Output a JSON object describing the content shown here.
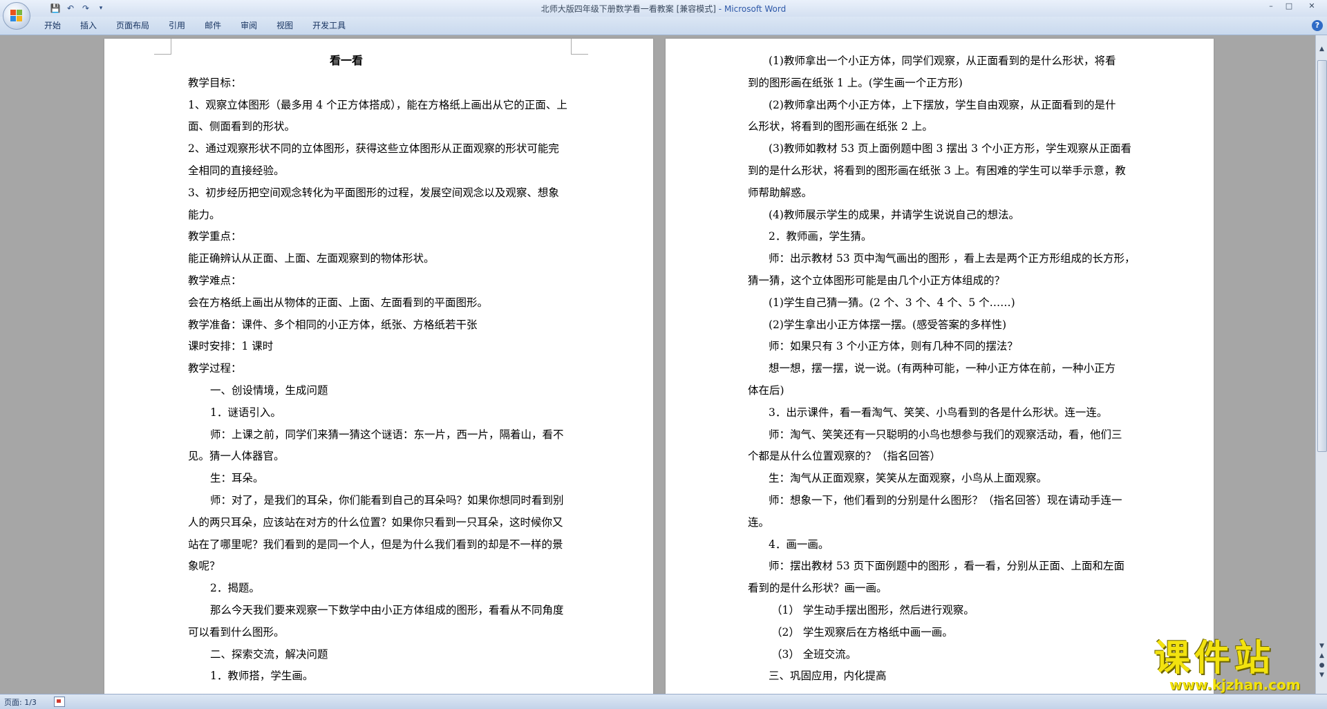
{
  "window": {
    "title": "北师大版四年级下册数学看一看教案 [兼容模式]",
    "app": "- Microsoft Word",
    "buttons": {
      "min": "–",
      "max": "□",
      "close": "✕"
    }
  },
  "quick_access": {
    "save_icon": "save-icon",
    "undo_icon": "undo-icon",
    "redo_icon": "redo-icon",
    "more_icon": "dropdown-icon"
  },
  "ribbon": {
    "tabs": [
      "开始",
      "插入",
      "页面布局",
      "引用",
      "邮件",
      "审阅",
      "视图",
      "开发工具"
    ],
    "help": "?"
  },
  "page1": {
    "lines": [
      "看一看",
      "教学目标：",
      "1、观察立体图形（最多用 4 个正方体搭成），能在方格纸上画出从它的正面、上",
      "面、侧面看到的形状。",
      "2、通过观察形状不同的立体图形，获得这些立体图形从正面观察的形状可能完",
      "全相同的直接经验。",
      "3、初步经历把空间观念转化为平面图形的过程，发展空间观念以及观察、想象",
      "能力。",
      "教学重点：",
      "能正确辨认从正面、上面、左面观察到的物体形状。",
      "教学难点：",
      "会在方格纸上画出从物体的正面、上面、左面看到的平面图形。",
      "教学准备：课件、多个相同的小正方体，纸张、方格纸若干张",
      "课时安排：1 课时",
      "教学过程：",
      "一、创设情境，生成问题",
      "1．谜语引入。",
      "师：上课之前，同学们来猜一猜这个谜语：东一片，西一片，隔着山，看不",
      "见。猜一人体器官。",
      "生：耳朵。",
      "师：对了，是我们的耳朵，你们能看到自己的耳朵吗？如果你想同时看到别",
      "人的两只耳朵，应该站在对方的什么位置？如果你只看到一只耳朵，这时候你又",
      "站在了哪里呢？我们看到的是同一个人，但是为什么我们看到的却是不一样的景",
      "象呢？",
      "2．揭题。",
      "那么今天我们要来观察一下数学中由小正方体组成的图形，看看从不同角度",
      "可以看到什么图形。",
      "二、探索交流，解决问题",
      "1．教师搭，学生画。"
    ]
  },
  "page2": {
    "lines": [
      "(1)教师拿出一个小正方体，同学们观察，从正面看到的是什么形状，将看",
      "到的图形画在纸张 1 上。(学生画一个正方形)",
      "(2)教师拿出两个小正方体，上下摆放，学生自由观察，从正面看到的是什",
      "么形状，将看到的图形画在纸张 2 上。",
      "(3)教师如教材 53 页上面例题中图 3 摆出 3 个小正方形，学生观察从正面看",
      "到的是什么形状，将看到的图形画在纸张 3 上。有困难的学生可以举手示意，教",
      "师帮助解惑。",
      "(4)教师展示学生的成果，并请学生说说自己的想法。",
      "2．教师画，学生猜。",
      "师：出示教材 53 页中淘气画出的图形 ，看上去是两个正方形组成的长方形，",
      "猜一猜，这个立体图形可能是由几个小正方体组成的？",
      "(1)学生自己猜一猜。(2 个、3 个、4 个、5 个……)",
      "(2)学生拿出小正方体摆一摆。(感受答案的多样性)",
      "师：如果只有 3 个小正方体，则有几种不同的摆法？",
      "想一想，摆一摆，说一说。(有两种可能，一种小正方体在前，一种小正方",
      "体在后)",
      "3．出示课件，看一看淘气、笑笑、小鸟看到的各是什么形状。连一连。",
      "师：淘气、笑笑还有一只聪明的小鸟也想参与我们的观察活动，看，他们三",
      "个都是从什么位置观察的？（指名回答）",
      "生：淘气从正面观察，笑笑从左面观察，小鸟从上面观察。",
      "师：想象一下，他们看到的分别是什么图形？（指名回答）现在请动手连一",
      "连。",
      "4．画一画。",
      "师：摆出教材 53 页下面例题中的图形 ，看一看，分别从正面、上面和左面",
      "看到的是什么形状？画一画。",
      "（1） 学生动手摆出图形，然后进行观察。",
      "（2） 学生观察后在方格纸中画一画。",
      "（3） 全班交流。",
      "三、巩固应用，内化提高"
    ]
  },
  "statusbar": {
    "page_info": "页面: 1/3"
  },
  "watermark": {
    "title": "课件站",
    "url": "www.kjzhan.com"
  }
}
